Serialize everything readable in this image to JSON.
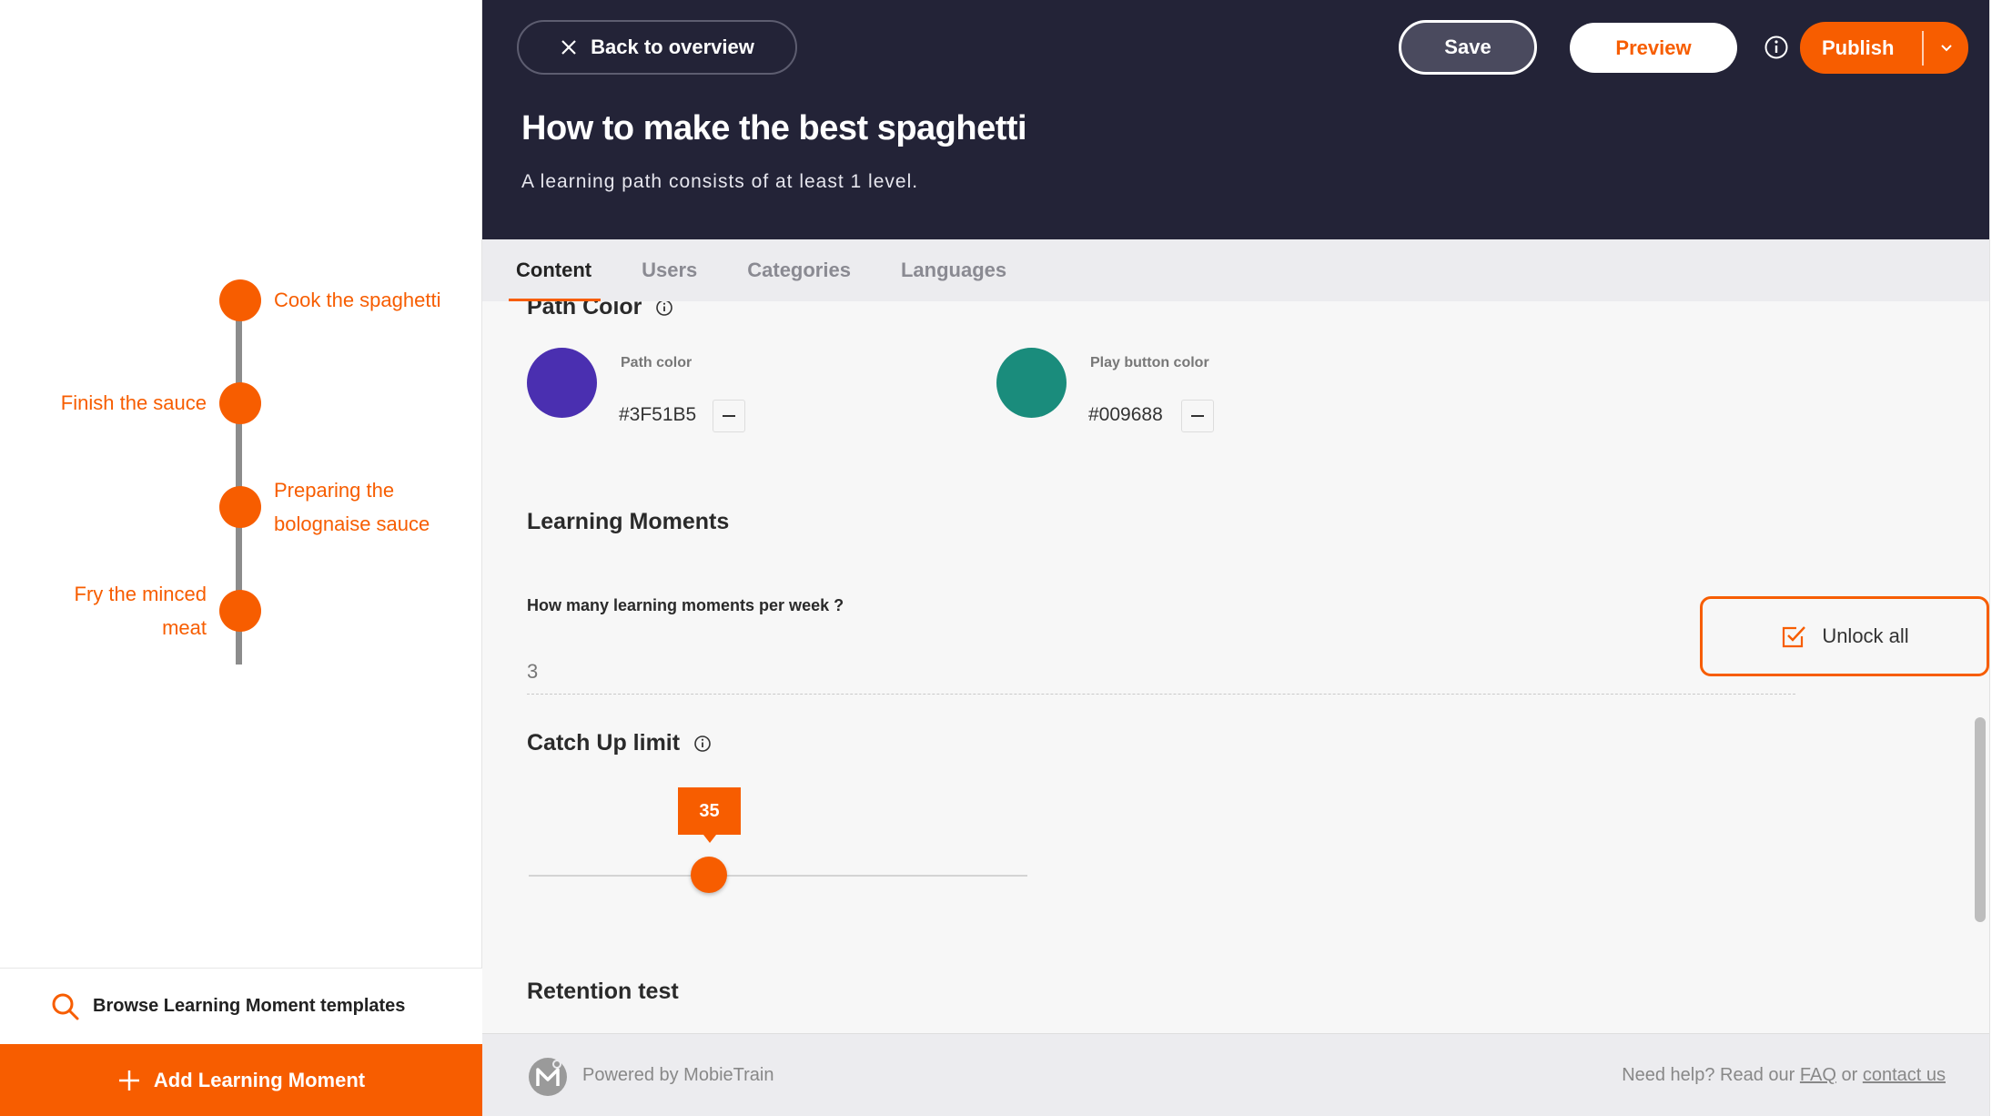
{
  "header": {
    "back_label": "Back to overview",
    "save_label": "Save",
    "preview_label": "Preview",
    "publish_label": "Publish",
    "title": "How to make the best spaghetti",
    "subtitle": "A learning path consists of at least 1 level."
  },
  "tabs": [
    {
      "label": "Content",
      "active": true
    },
    {
      "label": "Users"
    },
    {
      "label": "Categories"
    },
    {
      "label": "Languages"
    }
  ],
  "path": {
    "nodes": [
      {
        "label": "Cook the spaghetti"
      },
      {
        "label": "Finish the sauce"
      },
      {
        "label": "Preparing the bolognaise sauce"
      },
      {
        "label": "Fry the minced meat"
      }
    ]
  },
  "sidebar": {
    "browse_label": "Browse Learning Moment templates",
    "add_label": "Add Learning Moment"
  },
  "path_color": {
    "title": "Path Color",
    "path_label": "Path color",
    "path_value": "#3F51B5",
    "path_swatch": "#4a2fb0",
    "play_label": "Play button color",
    "play_value": "#009688",
    "play_swatch": "#1a8c7c"
  },
  "learning_moments": {
    "title": "Learning Moments",
    "question": "How many learning moments per week ?",
    "value": "3",
    "unlock_label": "Unlock all"
  },
  "catch_up": {
    "title": "Catch Up limit",
    "value": "35",
    "fraction": 0.26
  },
  "retention": {
    "title": "Retention test"
  },
  "footer": {
    "powered": "Powered by MobieTrain",
    "help_prefix": "Need help? Read our",
    "faq": "FAQ",
    "or": "or",
    "contact": "contact us"
  },
  "colors": {
    "accent": "#f75d00",
    "header_bg": "#232337"
  }
}
